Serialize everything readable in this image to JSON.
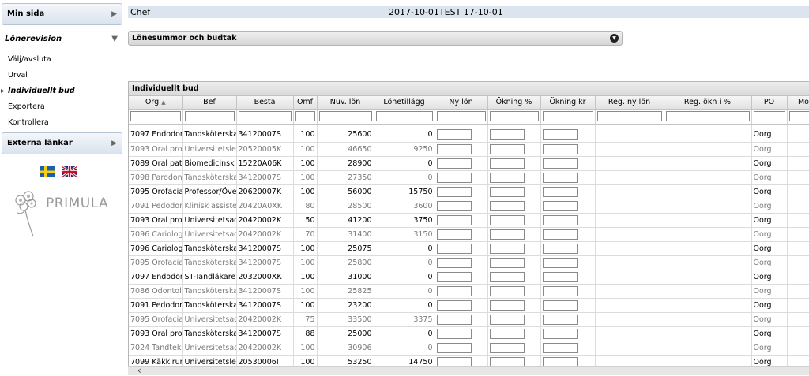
{
  "sidebar": {
    "min_sida": "Min sida",
    "lonerevision": "Lönerevision",
    "items": [
      {
        "label": "Välj/avsluta",
        "active": false
      },
      {
        "label": "Urval",
        "active": false
      },
      {
        "label": "Individuellt bud",
        "active": true
      },
      {
        "label": "Exportera",
        "active": false
      },
      {
        "label": "Kontrollera",
        "active": false
      }
    ],
    "externa_lankar": "Externa länkar",
    "logo_text": "PRIMULA"
  },
  "topbar": {
    "role": "Chef",
    "period": "2017-10-01TEST 17-10-01"
  },
  "accordion": {
    "title": "Lönesummor och budtak"
  },
  "grid": {
    "title": "Individuellt bud",
    "columns": [
      "Org",
      "Bef",
      "Besta",
      "Omf",
      "Nuv. lön",
      "Lönetillägg",
      "Ny lön",
      "Ökning %",
      "Ökning kr",
      "Reg. ny lön",
      "Reg. ökn i %",
      "PO",
      "Mo"
    ],
    "rows": [
      {
        "org": "7097 Endodont",
        "bef": "Tandsköterska",
        "besta": "34120007S",
        "omf": "100",
        "nuv": "25600",
        "tillagg": "0",
        "po": "Oorg",
        "dim": false
      },
      {
        "org": "7093 Oral prot",
        "bef": "Universitetslek",
        "besta": "20520005K",
        "omf": "100",
        "nuv": "46650",
        "tillagg": "9250",
        "po": "Oorg",
        "dim": true
      },
      {
        "org": "7089 Oral pato",
        "bef": "Biomedicinsk a",
        "besta": "15220A06K",
        "omf": "100",
        "nuv": "28900",
        "tillagg": "0",
        "po": "Oorg",
        "dim": false
      },
      {
        "org": "7098 Parodont",
        "bef": "Tandsköterska",
        "besta": "34120007S",
        "omf": "100",
        "nuv": "27350",
        "tillagg": "0",
        "po": "Oorg",
        "dim": true
      },
      {
        "org": "7095 Orofacial",
        "bef": "Professor/Över",
        "besta": "20620007K",
        "omf": "100",
        "nuv": "56000",
        "tillagg": "15750",
        "po": "Oorg",
        "dim": false
      },
      {
        "org": "7091 Pedodont",
        "bef": "Klinisk assister",
        "besta": "20420A0XK",
        "omf": "80",
        "nuv": "28500",
        "tillagg": "3600",
        "po": "Oorg",
        "dim": true
      },
      {
        "org": "7093 Oral prot",
        "bef": "Universitetsadj",
        "besta": "20420002K",
        "omf": "50",
        "nuv": "41200",
        "tillagg": "3750",
        "po": "Oorg",
        "dim": false
      },
      {
        "org": "7096 Cariologi",
        "bef": "Universitetsadj",
        "besta": "20420002K",
        "omf": "70",
        "nuv": "31400",
        "tillagg": "3150",
        "po": "Oorg",
        "dim": true
      },
      {
        "org": "7096 Cariologi",
        "bef": "Tandsköterska",
        "besta": "34120007S",
        "omf": "100",
        "nuv": "25075",
        "tillagg": "0",
        "po": "Oorg",
        "dim": false
      },
      {
        "org": "7095 Orofacial",
        "bef": "Tandsköterska",
        "besta": "34120007S",
        "omf": "100",
        "nuv": "25800",
        "tillagg": "0",
        "po": "Oorg",
        "dim": true
      },
      {
        "org": "7097 Endodont",
        "bef": "ST-Tandläkare",
        "besta": "2032000XK",
        "omf": "100",
        "nuv": "31000",
        "tillagg": "0",
        "po": "Oorg",
        "dim": false
      },
      {
        "org": "7086 Odontolo",
        "bef": "Tandsköterska",
        "besta": "34120007S",
        "omf": "100",
        "nuv": "25825",
        "tillagg": "0",
        "po": "Oorg",
        "dim": true
      },
      {
        "org": "7091 Pedodont",
        "bef": "Tandsköterska",
        "besta": "34120007S",
        "omf": "100",
        "nuv": "23200",
        "tillagg": "0",
        "po": "Oorg",
        "dim": false
      },
      {
        "org": "7095 Orofacial",
        "bef": "Universitetsadj",
        "besta": "20420002K",
        "omf": "75",
        "nuv": "33500",
        "tillagg": "3375",
        "po": "Oorg",
        "dim": true
      },
      {
        "org": "7093 Oral prot",
        "bef": "Tandsköterska",
        "besta": "34120007S",
        "omf": "88",
        "nuv": "25000",
        "tillagg": "0",
        "po": "Oorg",
        "dim": false
      },
      {
        "org": "7024 Tandtekn",
        "bef": "Universitetsadj",
        "besta": "20420002K",
        "omf": "100",
        "nuv": "30906",
        "tillagg": "0",
        "po": "Oorg",
        "dim": true
      },
      {
        "org": "7099 Käkkirurg",
        "bef": "Universitetslek",
        "besta": "20530006I",
        "omf": "100",
        "nuv": "53250",
        "tillagg": "14750",
        "po": "Oorg",
        "dim": false
      }
    ]
  },
  "colors": {
    "topbar_bg": "#dce4ef",
    "sidebar_header_bg": "#d9e2ee",
    "dim_text": "#7a7a7a"
  },
  "icons": {
    "sort_ascending": "sort-ascending-icon",
    "accordion_toggle": "chevron-down-circle-icon",
    "flag_se": "flag-sweden-icon",
    "flag_uk": "flag-uk-icon",
    "logo": "primula-flower-logo"
  }
}
